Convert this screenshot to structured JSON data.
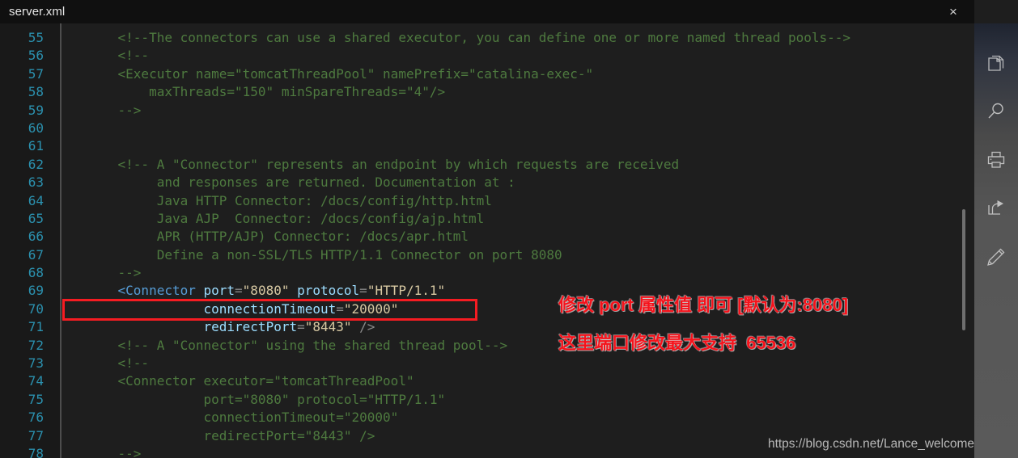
{
  "window": {
    "tab_title": "server.xml",
    "close_label": "×",
    "watermark": "https://blog.csdn.net/Lance_welcome"
  },
  "editor": {
    "language": "xml",
    "first_line": 55,
    "last_line": 78,
    "line_numbers": [
      55,
      56,
      57,
      58,
      59,
      60,
      61,
      62,
      63,
      64,
      65,
      66,
      67,
      68,
      69,
      70,
      71,
      72,
      73,
      74,
      75,
      76,
      77,
      78
    ],
    "lines": [
      {
        "n": 55,
        "text": "    <!--The connectors can use a shared executor, you can define one or more named thread pools-->"
      },
      {
        "n": 56,
        "text": "    <!--"
      },
      {
        "n": 57,
        "text": "    <Executor name=\"tomcatThreadPool\" namePrefix=\"catalina-exec-\""
      },
      {
        "n": 58,
        "text": "        maxThreads=\"150\" minSpareThreads=\"4\"/>"
      },
      {
        "n": 59,
        "text": "    -->"
      },
      {
        "n": 60,
        "text": ""
      },
      {
        "n": 61,
        "text": ""
      },
      {
        "n": 62,
        "text": "    <!-- A \"Connector\" represents an endpoint by which requests are received"
      },
      {
        "n": 63,
        "text": "         and responses are returned. Documentation at :"
      },
      {
        "n": 64,
        "text": "         Java HTTP Connector: /docs/config/http.html"
      },
      {
        "n": 65,
        "text": "         Java AJP  Connector: /docs/config/ajp.html"
      },
      {
        "n": 66,
        "text": "         APR (HTTP/AJP) Connector: /docs/apr.html"
      },
      {
        "n": 67,
        "text": "         Define a non-SSL/TLS HTTP/1.1 Connector on port 8080"
      },
      {
        "n": 68,
        "text": "    -->"
      },
      {
        "n": 69,
        "text": "    <Connector port=\"8080\" protocol=\"HTTP/1.1\""
      },
      {
        "n": 70,
        "text": "               connectionTimeout=\"20000\""
      },
      {
        "n": 71,
        "text": "               redirectPort=\"8443\" />"
      },
      {
        "n": 72,
        "text": "    <!-- A \"Connector\" using the shared thread pool-->"
      },
      {
        "n": 73,
        "text": "    <!--"
      },
      {
        "n": 74,
        "text": "    <Connector executor=\"tomcatThreadPool\""
      },
      {
        "n": 75,
        "text": "               port=\"8080\" protocol=\"HTTP/1.1\""
      },
      {
        "n": 76,
        "text": "               connectionTimeout=\"20000\""
      },
      {
        "n": 77,
        "text": "               redirectPort=\"8443\" />"
      },
      {
        "n": 78,
        "text": "    -->"
      }
    ],
    "tokens": {
      "l55": "    <!--The connectors can use a shared executor, you can define one or more named thread pools-->",
      "l56": "    <!--",
      "l57": "    <Executor name=\"tomcatThreadPool\" namePrefix=\"catalina-exec-\"",
      "l58": "        maxThreads=\"150\" minSpareThreads=\"4\"/>",
      "l59": "    -->",
      "l62": "    <!-- A \"Connector\" represents an endpoint by which requests are received",
      "l63": "         and responses are returned. Documentation at :",
      "l64": "         Java HTTP Connector: /docs/config/http.html",
      "l65": "         Java AJP  Connector: /docs/config/ajp.html",
      "l66": "         APR (HTTP/AJP) Connector: /docs/apr.html",
      "l67": "         Define a non-SSL/TLS HTTP/1.1 Connector on port 8080",
      "l68": "    -->",
      "l69_indent": "    ",
      "l69_tag": "<Connector",
      "l69_attr_port": " port",
      "l69_eq1": "=",
      "l69_val_port": "\"8080\"",
      "l69_attr_protocol": " protocol",
      "l69_eq2": "=",
      "l69_val_protocol": "\"HTTP/1.1\"",
      "l70_indent": "               ",
      "l70_attr": "connectionTimeout",
      "l70_eq": "=",
      "l70_val": "\"20000\"",
      "l71_indent": "               ",
      "l71_attr": "redirectPort",
      "l71_eq": "=",
      "l71_val": "\"8443\"",
      "l71_close": " />",
      "l72": "    <!-- A \"Connector\" using the shared thread pool-->",
      "l73": "    <!--",
      "l74": "    <Connector executor=\"tomcatThreadPool\"",
      "l75": "               port=\"8080\" protocol=\"HTTP/1.1\"",
      "l76": "               connectionTimeout=\"20000\"",
      "l77": "               redirectPort=\"8443\" />",
      "l78": "    -->"
    }
  },
  "annotations": {
    "line1": "修改 port 属性值 即可 [默认为:8080]",
    "line2": "这里端口修改最大支持  65536",
    "highlight_target_line": 69,
    "highlight_color": "#f51c22",
    "text_color": "#f5121b"
  },
  "sidebar": {
    "items": [
      {
        "name": "copy-icon",
        "label": "Copy"
      },
      {
        "name": "search-icon",
        "label": "Search"
      },
      {
        "name": "print-icon",
        "label": "Print"
      },
      {
        "name": "share-icon",
        "label": "Share"
      },
      {
        "name": "edit-icon",
        "label": "Edit"
      }
    ]
  },
  "colors": {
    "editor_bg": "#1e1e1e",
    "gutter_bg": "#191919",
    "titlebar_bg": "#101010",
    "line_number": "#2b91af",
    "comment": "#4e7a3f",
    "tag": "#569cd6",
    "attribute": "#9cdcfe",
    "value": "#d8c9a3",
    "punctuation": "#8a8a8a",
    "annotation_red": "#f5121b"
  }
}
